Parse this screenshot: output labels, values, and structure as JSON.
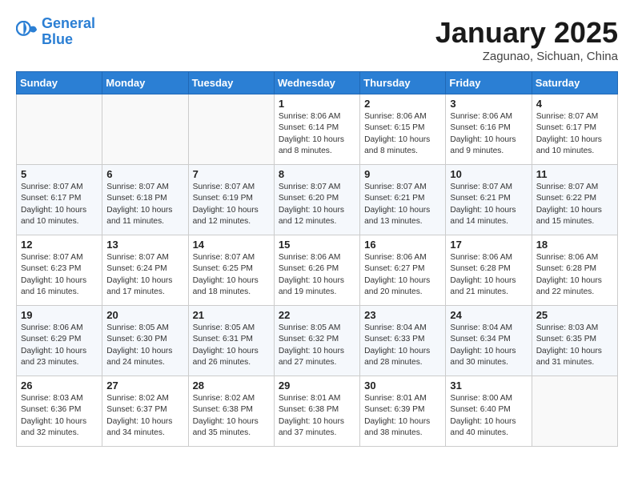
{
  "header": {
    "logo_line1": "General",
    "logo_line2": "Blue",
    "title": "January 2025",
    "subtitle": "Zagunao, Sichuan, China"
  },
  "weekdays": [
    "Sunday",
    "Monday",
    "Tuesday",
    "Wednesday",
    "Thursday",
    "Friday",
    "Saturday"
  ],
  "weeks": [
    [
      {
        "day": "",
        "info": ""
      },
      {
        "day": "",
        "info": ""
      },
      {
        "day": "",
        "info": ""
      },
      {
        "day": "1",
        "info": "Sunrise: 8:06 AM\nSunset: 6:14 PM\nDaylight: 10 hours\nand 8 minutes."
      },
      {
        "day": "2",
        "info": "Sunrise: 8:06 AM\nSunset: 6:15 PM\nDaylight: 10 hours\nand 8 minutes."
      },
      {
        "day": "3",
        "info": "Sunrise: 8:06 AM\nSunset: 6:16 PM\nDaylight: 10 hours\nand 9 minutes."
      },
      {
        "day": "4",
        "info": "Sunrise: 8:07 AM\nSunset: 6:17 PM\nDaylight: 10 hours\nand 10 minutes."
      }
    ],
    [
      {
        "day": "5",
        "info": "Sunrise: 8:07 AM\nSunset: 6:17 PM\nDaylight: 10 hours\nand 10 minutes."
      },
      {
        "day": "6",
        "info": "Sunrise: 8:07 AM\nSunset: 6:18 PM\nDaylight: 10 hours\nand 11 minutes."
      },
      {
        "day": "7",
        "info": "Sunrise: 8:07 AM\nSunset: 6:19 PM\nDaylight: 10 hours\nand 12 minutes."
      },
      {
        "day": "8",
        "info": "Sunrise: 8:07 AM\nSunset: 6:20 PM\nDaylight: 10 hours\nand 12 minutes."
      },
      {
        "day": "9",
        "info": "Sunrise: 8:07 AM\nSunset: 6:21 PM\nDaylight: 10 hours\nand 13 minutes."
      },
      {
        "day": "10",
        "info": "Sunrise: 8:07 AM\nSunset: 6:21 PM\nDaylight: 10 hours\nand 14 minutes."
      },
      {
        "day": "11",
        "info": "Sunrise: 8:07 AM\nSunset: 6:22 PM\nDaylight: 10 hours\nand 15 minutes."
      }
    ],
    [
      {
        "day": "12",
        "info": "Sunrise: 8:07 AM\nSunset: 6:23 PM\nDaylight: 10 hours\nand 16 minutes."
      },
      {
        "day": "13",
        "info": "Sunrise: 8:07 AM\nSunset: 6:24 PM\nDaylight: 10 hours\nand 17 minutes."
      },
      {
        "day": "14",
        "info": "Sunrise: 8:07 AM\nSunset: 6:25 PM\nDaylight: 10 hours\nand 18 minutes."
      },
      {
        "day": "15",
        "info": "Sunrise: 8:06 AM\nSunset: 6:26 PM\nDaylight: 10 hours\nand 19 minutes."
      },
      {
        "day": "16",
        "info": "Sunrise: 8:06 AM\nSunset: 6:27 PM\nDaylight: 10 hours\nand 20 minutes."
      },
      {
        "day": "17",
        "info": "Sunrise: 8:06 AM\nSunset: 6:28 PM\nDaylight: 10 hours\nand 21 minutes."
      },
      {
        "day": "18",
        "info": "Sunrise: 8:06 AM\nSunset: 6:28 PM\nDaylight: 10 hours\nand 22 minutes."
      }
    ],
    [
      {
        "day": "19",
        "info": "Sunrise: 8:06 AM\nSunset: 6:29 PM\nDaylight: 10 hours\nand 23 minutes."
      },
      {
        "day": "20",
        "info": "Sunrise: 8:05 AM\nSunset: 6:30 PM\nDaylight: 10 hours\nand 24 minutes."
      },
      {
        "day": "21",
        "info": "Sunrise: 8:05 AM\nSunset: 6:31 PM\nDaylight: 10 hours\nand 26 minutes."
      },
      {
        "day": "22",
        "info": "Sunrise: 8:05 AM\nSunset: 6:32 PM\nDaylight: 10 hours\nand 27 minutes."
      },
      {
        "day": "23",
        "info": "Sunrise: 8:04 AM\nSunset: 6:33 PM\nDaylight: 10 hours\nand 28 minutes."
      },
      {
        "day": "24",
        "info": "Sunrise: 8:04 AM\nSunset: 6:34 PM\nDaylight: 10 hours\nand 30 minutes."
      },
      {
        "day": "25",
        "info": "Sunrise: 8:03 AM\nSunset: 6:35 PM\nDaylight: 10 hours\nand 31 minutes."
      }
    ],
    [
      {
        "day": "26",
        "info": "Sunrise: 8:03 AM\nSunset: 6:36 PM\nDaylight: 10 hours\nand 32 minutes."
      },
      {
        "day": "27",
        "info": "Sunrise: 8:02 AM\nSunset: 6:37 PM\nDaylight: 10 hours\nand 34 minutes."
      },
      {
        "day": "28",
        "info": "Sunrise: 8:02 AM\nSunset: 6:38 PM\nDaylight: 10 hours\nand 35 minutes."
      },
      {
        "day": "29",
        "info": "Sunrise: 8:01 AM\nSunset: 6:38 PM\nDaylight: 10 hours\nand 37 minutes."
      },
      {
        "day": "30",
        "info": "Sunrise: 8:01 AM\nSunset: 6:39 PM\nDaylight: 10 hours\nand 38 minutes."
      },
      {
        "day": "31",
        "info": "Sunrise: 8:00 AM\nSunset: 6:40 PM\nDaylight: 10 hours\nand 40 minutes."
      },
      {
        "day": "",
        "info": ""
      }
    ]
  ]
}
